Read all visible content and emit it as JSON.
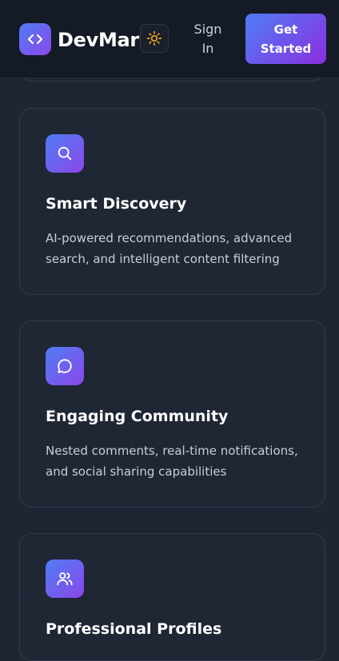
{
  "header": {
    "brand": "DevMark",
    "logo_icon": "code-brackets-icon",
    "theme_icon": "sun-icon",
    "signin_label": "Sign In",
    "cta_label": "Get Started"
  },
  "features": [
    {
      "icon": "search-icon",
      "title": "Smart Discovery",
      "description": "AI-powered recommendations, advanced search, and intelligent content filtering"
    },
    {
      "icon": "chat-bubble-icon",
      "title": "Engaging Community",
      "description": "Nested comments, real-time notifications, and social sharing capabilities"
    },
    {
      "icon": "users-icon",
      "title": "Professional Profiles",
      "description": ""
    }
  ],
  "colors": {
    "accent_start": "#4f7df5",
    "accent_end": "#8b47e8",
    "sun": "#f5a524",
    "background": "#1e2533"
  }
}
